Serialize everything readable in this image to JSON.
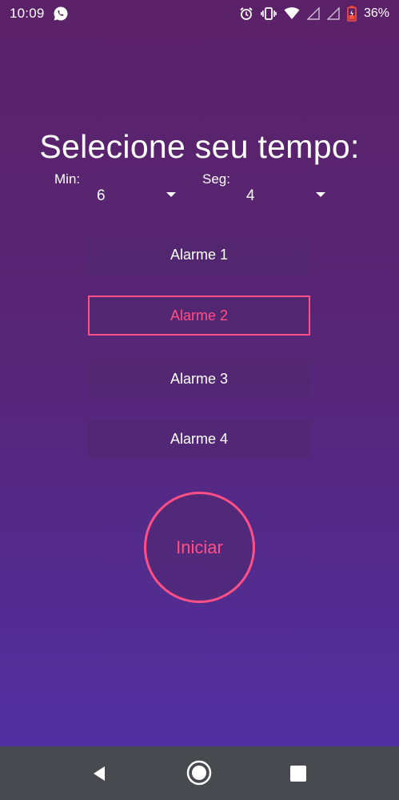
{
  "status_bar": {
    "time": "10:09",
    "battery_percent": "36%",
    "icons": [
      "whatsapp-icon",
      "alarm-clock-icon",
      "vibrate-icon",
      "wifi-icon",
      "signal-icon",
      "signal-icon",
      "battery-icon"
    ]
  },
  "main": {
    "title": "Selecione seu tempo:",
    "minutes": {
      "label": "Min:",
      "value": "6"
    },
    "seconds": {
      "label": "Seg:",
      "value": "4"
    },
    "alarms": [
      {
        "label": "Alarme 1",
        "selected": false
      },
      {
        "label": "Alarme 2",
        "selected": true
      },
      {
        "label": "Alarme 3",
        "selected": false
      },
      {
        "label": "Alarme 4",
        "selected": false
      }
    ],
    "start_label": "Iniciar"
  },
  "nav_bar": {
    "icons": [
      "back-icon",
      "home-icon",
      "recent-apps-icon"
    ]
  },
  "colors": {
    "accent": "#ff4f87",
    "background_top": "#5b2168",
    "background_bottom": "#4f31a6",
    "nav_bar": "#474a4f"
  }
}
